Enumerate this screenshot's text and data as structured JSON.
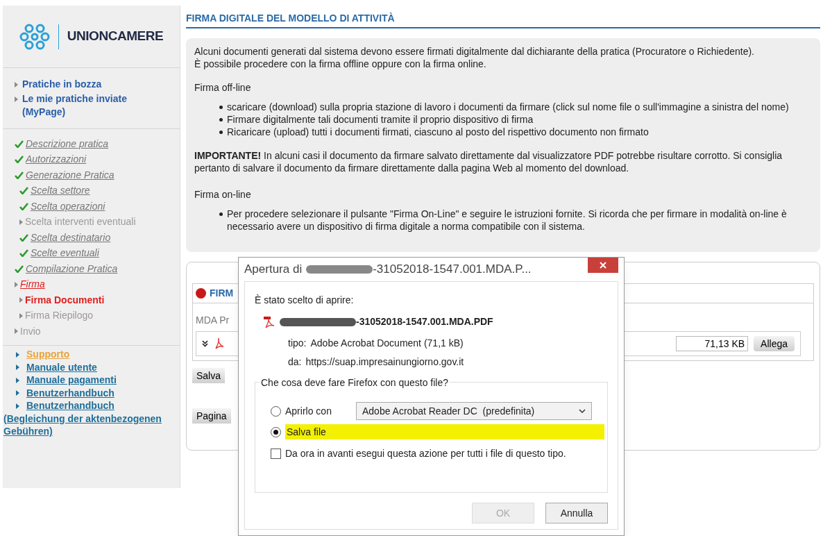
{
  "brand": {
    "name": "UNIONCAMERE"
  },
  "sidebar": {
    "links": [
      {
        "label": "Pratiche in bozza"
      },
      {
        "label": "Le mie pratiche inviate (MyPage)"
      }
    ],
    "steps": [
      {
        "label": "Descrizione pratica",
        "done": true,
        "active": false,
        "selected": false
      },
      {
        "label": "Autorizzazioni",
        "done": true,
        "active": false,
        "selected": false
      },
      {
        "label": "Generazione Pratica",
        "done": true,
        "active": false,
        "selected": false,
        "children": [
          {
            "label": "Scelta settore",
            "done": true,
            "active": false,
            "selected": false
          },
          {
            "label": "Scelta operazioni",
            "done": true,
            "active": false,
            "selected": false
          },
          {
            "label": "Scelta interventi eventuali",
            "done": false,
            "active": false,
            "selected": false
          },
          {
            "label": "Scelta destinatario",
            "done": true,
            "active": false,
            "selected": false
          },
          {
            "label": "Scelte eventuali",
            "done": true,
            "active": false,
            "selected": false
          }
        ]
      },
      {
        "label": "Compilazione Pratica",
        "done": true,
        "active": false,
        "selected": false
      },
      {
        "label": "Firma",
        "done": false,
        "active": true,
        "selected": false,
        "children": [
          {
            "label": "Firma Documenti",
            "done": false,
            "active": true,
            "selected": true
          },
          {
            "label": "Firma Riepilogo",
            "done": false,
            "active": false,
            "selected": false
          }
        ]
      },
      {
        "label": "Invio",
        "done": false,
        "active": false,
        "selected": false
      }
    ],
    "help_links": [
      {
        "label": "Supporto",
        "color": "#e8a33a"
      },
      {
        "label": "Manuale utente",
        "color": "#1f6f9a"
      },
      {
        "label": "Manuale pagamenti",
        "color": "#1f6f9a"
      },
      {
        "label": "Benutzerhandbuch",
        "color": "#1f6f9a"
      },
      {
        "label": "Benutzerhandbuch",
        "color": "#1f6f9a"
      }
    ],
    "help_note": "(Begleichung der aktenbezogenen Gebühren)"
  },
  "main": {
    "title": "FIRMA DIGITALE DEL MODELLO DI ATTIVITÀ",
    "intro": [
      "Alcuni documenti generati dal sistema devono essere firmati digitalmente dal dichiarante della pratica (Procuratore o Richiedente).",
      "È possibile procedere con la firma offline oppure con la firma online."
    ],
    "offline_heading": "Firma off-line",
    "offline_steps": [
      "scaricare (download) sulla propria stazione di lavoro i documenti da firmare (click sul nome file o sull'immagine a sinistra del nome)",
      "Firmare digitalmente tali documenti tramite il proprio dispositivo di firma",
      "Ricaricare (upload) tutti i documenti firmati, ciascuno al posto del rispettivo documento non firmato"
    ],
    "warning": "**IMPORTANTE!** In alcuni casi il documento da firmare salvato direttamente dal visualizzatore PDF potrebbe risultare corrotto. Si consiglia pertanto di salvare il documento da firmare direttamente dalla pagina Web al momento del download.",
    "online_heading": "Firma on-line",
    "online_steps": [
      "Per procedere selezionare il pulsante \"Firma On-Line\" e seguire le istruzioni fornite. Si ricorda che per firmare in modalità on-line è necessario avere un dispositivo di firma digitale a norma compatibile con il sistema."
    ],
    "panel": {
      "header": "FIRM",
      "section": "MDA Pr",
      "size": "71,13 KB",
      "attach_button": "Allega",
      "save_button": "Salva",
      "page_button": "Pagina"
    }
  },
  "dialog": {
    "title_prefix": "Apertura di",
    "title_suffix": "-31052018-1547.001.MDA.P...",
    "chosen_label": "È stato scelto di aprire:",
    "file_suffix": "-31052018-1547.001.MDA.PDF",
    "type_label": "tipo:",
    "type_value": "Adobe Acrobat Document (71,1 kB)",
    "from_label": "da:",
    "from_value": "https://suap.impresainungiorno.gov.it",
    "question": "Che cosa deve fare Firefox con questo file?",
    "options": [
      {
        "label": "Aprirlo con",
        "selected": false,
        "highlighted": false,
        "app": "Adobe Acrobat Reader DC  (predefinita)"
      },
      {
        "label": "Salva file",
        "selected": true,
        "highlighted": true
      }
    ],
    "remember": {
      "label": "Da ora in avanti esegui questa azione per tutti i file di questo tipo.",
      "checked": false
    },
    "buttons": [
      {
        "label": "OK",
        "disabled": true
      },
      {
        "label": "Annulla",
        "disabled": false
      }
    ]
  }
}
